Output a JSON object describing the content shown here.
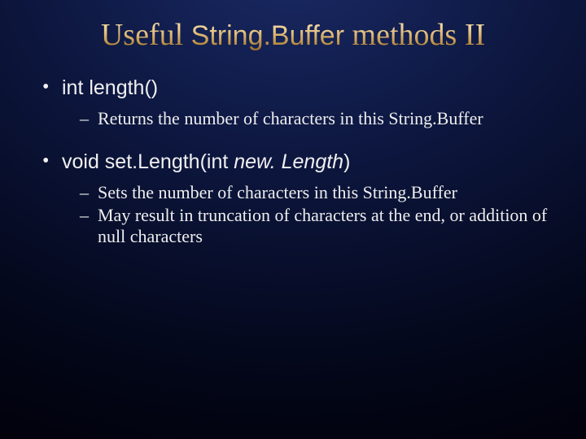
{
  "title": {
    "pre": "Useful ",
    "code": "String.Buffer",
    "post": " methods II"
  },
  "bullets": [
    {
      "sig": {
        "prefix": "int length()",
        "italic": "",
        "suffix": ""
      },
      "subs": [
        "Returns the number of characters in this String.Buffer"
      ]
    },
    {
      "sig": {
        "prefix": "void set.Length(int ",
        "italic": "new. Length",
        "suffix": ")"
      },
      "subs": [
        "Sets the number of characters in this String.Buffer",
        "May result in truncation of characters at the end, or addition of null characters"
      ]
    }
  ]
}
